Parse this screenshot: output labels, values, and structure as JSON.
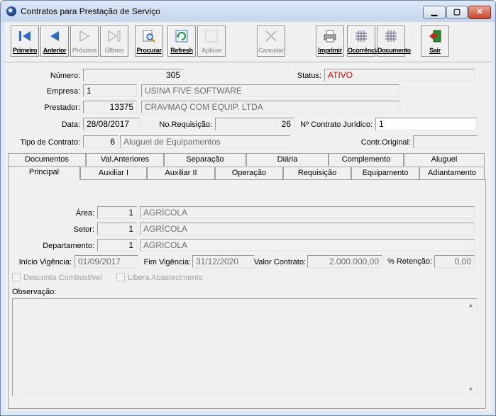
{
  "window": {
    "title": "Contratos para Prestação de Serviço"
  },
  "toolbar": {
    "buttons": [
      {
        "label": "Primeiro",
        "enabled": true
      },
      {
        "label": "Anterior",
        "enabled": true
      },
      {
        "label": "Próximo",
        "enabled": false
      },
      {
        "label": "Último",
        "enabled": false
      },
      {
        "label": "Procurar",
        "enabled": true
      },
      {
        "label": "Refresh",
        "enabled": true
      },
      {
        "label": "Aplicar",
        "enabled": false
      },
      {
        "label": "Cancelar",
        "enabled": false
      },
      {
        "label": "Imprimir",
        "enabled": true
      },
      {
        "label": "Ocorrência",
        "enabled": true
      },
      {
        "label": "Documento",
        "enabled": true
      },
      {
        "label": "Sair",
        "enabled": true
      }
    ]
  },
  "form": {
    "numero": {
      "label": "Número:",
      "value": "305"
    },
    "status": {
      "label": "Status:",
      "value": "ATIVO"
    },
    "empresa": {
      "label": "Empresa:",
      "code": "1",
      "name": "USINA FIVE SOFTWARE"
    },
    "prestador": {
      "label": "Prestador:",
      "code": "13375",
      "name": "CRAVMAQ COM EQUIP. LTDA"
    },
    "data": {
      "label": "Data:",
      "value": "28/08/2017"
    },
    "requisicao": {
      "label": "No.Requisição:",
      "value": "26"
    },
    "contrato_juridico": {
      "label": "Nº Contrato Jurídico:",
      "value": "1"
    },
    "tipo_contrato": {
      "label": "Tipo de Contrato:",
      "code": "6",
      "name": "Aluguel de Equipamentos"
    },
    "contr_original": {
      "label": "Contr.Original:",
      "value": ""
    }
  },
  "tabs": {
    "row1": [
      "Documentos",
      "Val.Anteriores",
      "Separação",
      "Diária",
      "Complemento",
      "Aluguel"
    ],
    "row2": [
      "Principal",
      "Auxiliar I",
      "Auxiliar II",
      "Operação",
      "Requisição",
      "Equipamento",
      "Adiantamento"
    ],
    "active": "Principal"
  },
  "principal": {
    "area": {
      "label": "Área:",
      "code": "1",
      "name": "AGRÍCOLA"
    },
    "setor": {
      "label": "Setor:",
      "code": "1",
      "name": "AGRÍCOLA"
    },
    "departamento": {
      "label": "Departamento:",
      "code": "1",
      "name": "AGRICOLA"
    },
    "inicio_vigencia": {
      "label": "Início Vigência:",
      "value": "01/09/2017"
    },
    "fim_vigencia": {
      "label": "Fim Vigência:",
      "value": "31/12/2020"
    },
    "valor_contrato": {
      "label": "Valor Contrato:",
      "value": "2.000.000,00"
    },
    "retencao": {
      "label": "% Retenção:",
      "value": "0,00"
    },
    "desconta_combustivel": {
      "label": "Desconta Combustível",
      "checked": false
    },
    "libera_abastecimento": {
      "label": "Libera Abastecimento",
      "checked": false
    },
    "observacao": {
      "label": "Observação:",
      "value": ""
    }
  },
  "colors": {
    "status_text": "#e00000",
    "title_bar": "#c6d6ec"
  }
}
